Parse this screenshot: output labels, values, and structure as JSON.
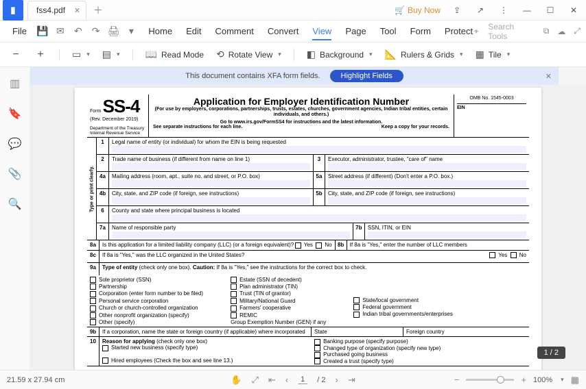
{
  "titlebar": {
    "tab_name": "fss4.pdf",
    "buy_now": "Buy Now"
  },
  "menubar": {
    "file": "File",
    "tabs": [
      "Home",
      "Edit",
      "Comment",
      "Convert",
      "View",
      "Page",
      "Tool",
      "Form",
      "Protect"
    ],
    "active_index": 4,
    "search_placeholder": "Search Tools"
  },
  "toolbar": {
    "read_mode": "Read Mode",
    "rotate_view": "Rotate View",
    "background": "Background",
    "rulers": "Rulers & Grids",
    "tile": "Tile"
  },
  "banner": {
    "text": "This document contains XFA form fields.",
    "button": "Highlight Fields"
  },
  "form": {
    "ss4": "SS-4",
    "form_word": "Form",
    "rev": "(Rev. December 2019)",
    "dept1": "Department of the Treasury",
    "dept2": "Internal Revenue Service",
    "title": "Application for Employer Identification Number",
    "sub": "(For use by employers, corporations, partnerships, trusts, estates, churches, government agencies, Indian tribal entities, certain individuals, and others.)",
    "go": "Go to www.irs.gov/FormSS4 for instructions and the latest information.",
    "see": "See separate instructions for each line.",
    "keep": "Keep a copy for your records.",
    "omb": "OMB No. 1545-0003",
    "ein": "EIN",
    "vlabel": "Type or print clearly.",
    "line1": "Legal name of entity (or individual) for whom the EIN is being requested",
    "line2": "Trade name of business (if different from name on line 1)",
    "line3": "Executor, administrator, trustee, \"care of\" name",
    "line4a": "Mailing address (room, apt., suite no. and street, or P.O. box)",
    "line5a": "Street address (if different) (Don't enter a P.O. box.)",
    "line4b": "City, state, and ZIP code (if foreign, see instructions)",
    "line5b": "City, state, and ZIP code (if foreign, see instructions)",
    "line6": "County and state where principal business is located",
    "line7a": "Name of responsible party",
    "line7b": "SSN, ITIN, or EIN",
    "line8a": "Is this application for a limited liability company (LLC) (or a foreign equivalent)?",
    "line8b": "If 8a is \"Yes,\" enter the number of LLC members",
    "line8c": "If 8a is \"Yes,\" was the LLC organized in the United States?",
    "yes": "Yes",
    "no": "No",
    "line9a_b": "Type of entity",
    "line9a_t1": " (check only one box). ",
    "line9a_c": "Caution:",
    "line9a_t2": " If 8a is \"Yes,\" see the instructions for the correct box to check.",
    "e_sole": "Sole proprietor (SSN)",
    "e_partner": "Partnership",
    "e_corp": "Corporation (enter form number to be filed)",
    "e_psc": "Personal service corporation",
    "e_church": "Church or church-controlled organization",
    "e_nonprof": "Other nonprofit organization (specify)",
    "e_other": "Other (specify)",
    "e_estate": "Estate (SSN of decedent)",
    "e_plan": "Plan administrator (TIN)",
    "e_trust": "Trust (TIN of grantor)",
    "e_mil": "Military/National Guard",
    "e_farm": "Farmers' cooperative",
    "e_remic": "REMIC",
    "e_stloc": "State/local government",
    "e_fed": "Federal government",
    "e_tribal": "Indian tribal governments/enterprises",
    "gen": "Group Exemption Number (GEN) if any",
    "line9b": "If a corporation, name the state or foreign country (if applicable) where incorporated",
    "state": "State",
    "foreign": "Foreign country",
    "line10_b": "Reason for applying",
    "line10_t": " (check only one box)",
    "r_started": "Started new business (specify type)",
    "r_hired": "Hired employees (Check the box and see line 13.)",
    "r_bank": "Banking purpose (specify purpose)",
    "r_changed": "Changed type of organization (specify new type)",
    "r_purch": "Purchased going business",
    "r_trust": "Created a trust (specify type)"
  },
  "page_badge": "1 / 2",
  "status": {
    "dims": "21.59 x 27.94 cm",
    "page_input": "1",
    "page_total": "/ 2",
    "zoom": "100%"
  }
}
